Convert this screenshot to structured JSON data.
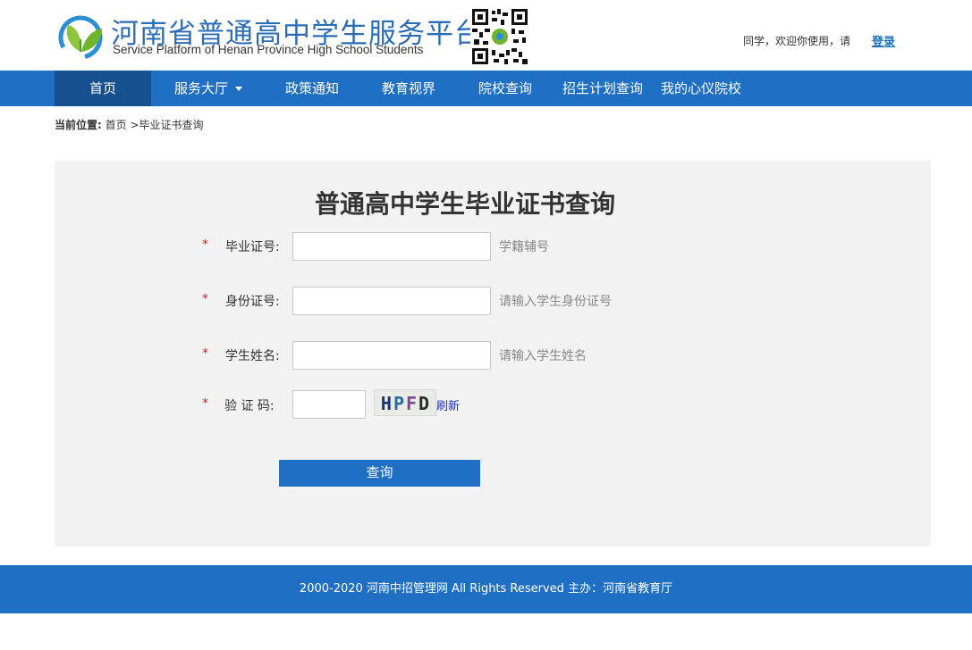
{
  "header": {
    "site_title": "河南省普通高中学生服务平台",
    "site_subtitle": "Service Platform of Henan Province High School Students",
    "greeting": "同学，欢迎你使用，请",
    "login_label": "登录",
    "brand_color": "#2b6cb8"
  },
  "nav": {
    "items": [
      {
        "label": "首页",
        "active": true
      },
      {
        "label": "服务大厅",
        "has_dropdown": true
      },
      {
        "label": "政策通知"
      },
      {
        "label": "教育视界"
      },
      {
        "label": "院校查询"
      },
      {
        "label": "招生计划查询"
      },
      {
        "label": "我的心仪院校"
      }
    ],
    "bg_color": "#1f6fc5",
    "active_color": "#17508f"
  },
  "breadcrumb": {
    "label": "当前位置:",
    "home": "首页",
    "separator": ">",
    "current": "毕业证书查询"
  },
  "form": {
    "title": "普通高中学生毕业证书查询",
    "required_mark": "*",
    "fields": [
      {
        "label": "毕业证号:",
        "value": "",
        "hint": "学籍辅号"
      },
      {
        "label": "身份证号:",
        "value": "",
        "hint": "请输入学生身份证号"
      },
      {
        "label": "学生姓名:",
        "value": "",
        "hint": "请输入学生姓名"
      },
      {
        "label": "验 证 码:",
        "value": ""
      }
    ],
    "captcha_chars": [
      "H",
      "P",
      "F",
      "D"
    ],
    "refresh_label": "刷新",
    "submit_label": "查询"
  },
  "footer": {
    "text": "2000-2020 河南中招管理网 All Rights Reserved 主办：河南省教育厅"
  }
}
